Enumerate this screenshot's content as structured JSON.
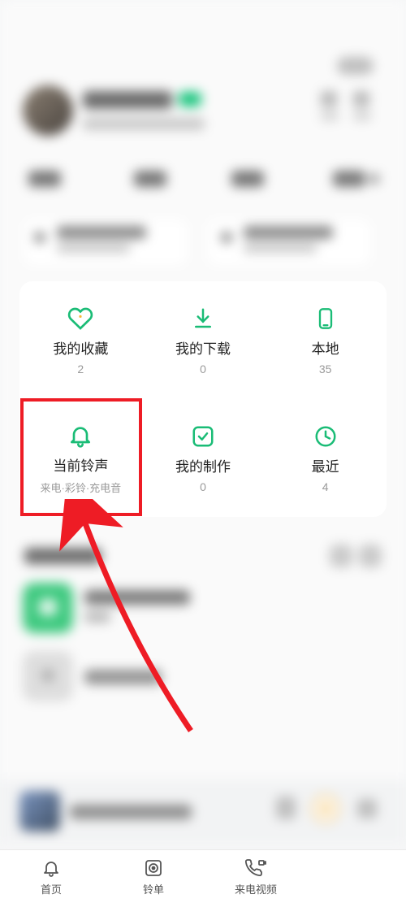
{
  "header": {
    "username_placeholder": "",
    "settings_label": ""
  },
  "grid": {
    "favorites": {
      "label": "我的收藏",
      "count": "2"
    },
    "downloads": {
      "label": "我的下载",
      "count": "0"
    },
    "local": {
      "label": "本地",
      "count": "35"
    },
    "current_ring": {
      "label": "当前铃声",
      "sub": "来电·彩铃·充电音"
    },
    "my_make": {
      "label": "我的制作",
      "count": "0"
    },
    "recent": {
      "label": "最近",
      "count": "4"
    }
  },
  "nav": {
    "home": "首页",
    "ring_list": "铃单",
    "call_video": "来电视频"
  },
  "colors": {
    "accent": "#1abc76",
    "highlight": "#ee1c25"
  }
}
